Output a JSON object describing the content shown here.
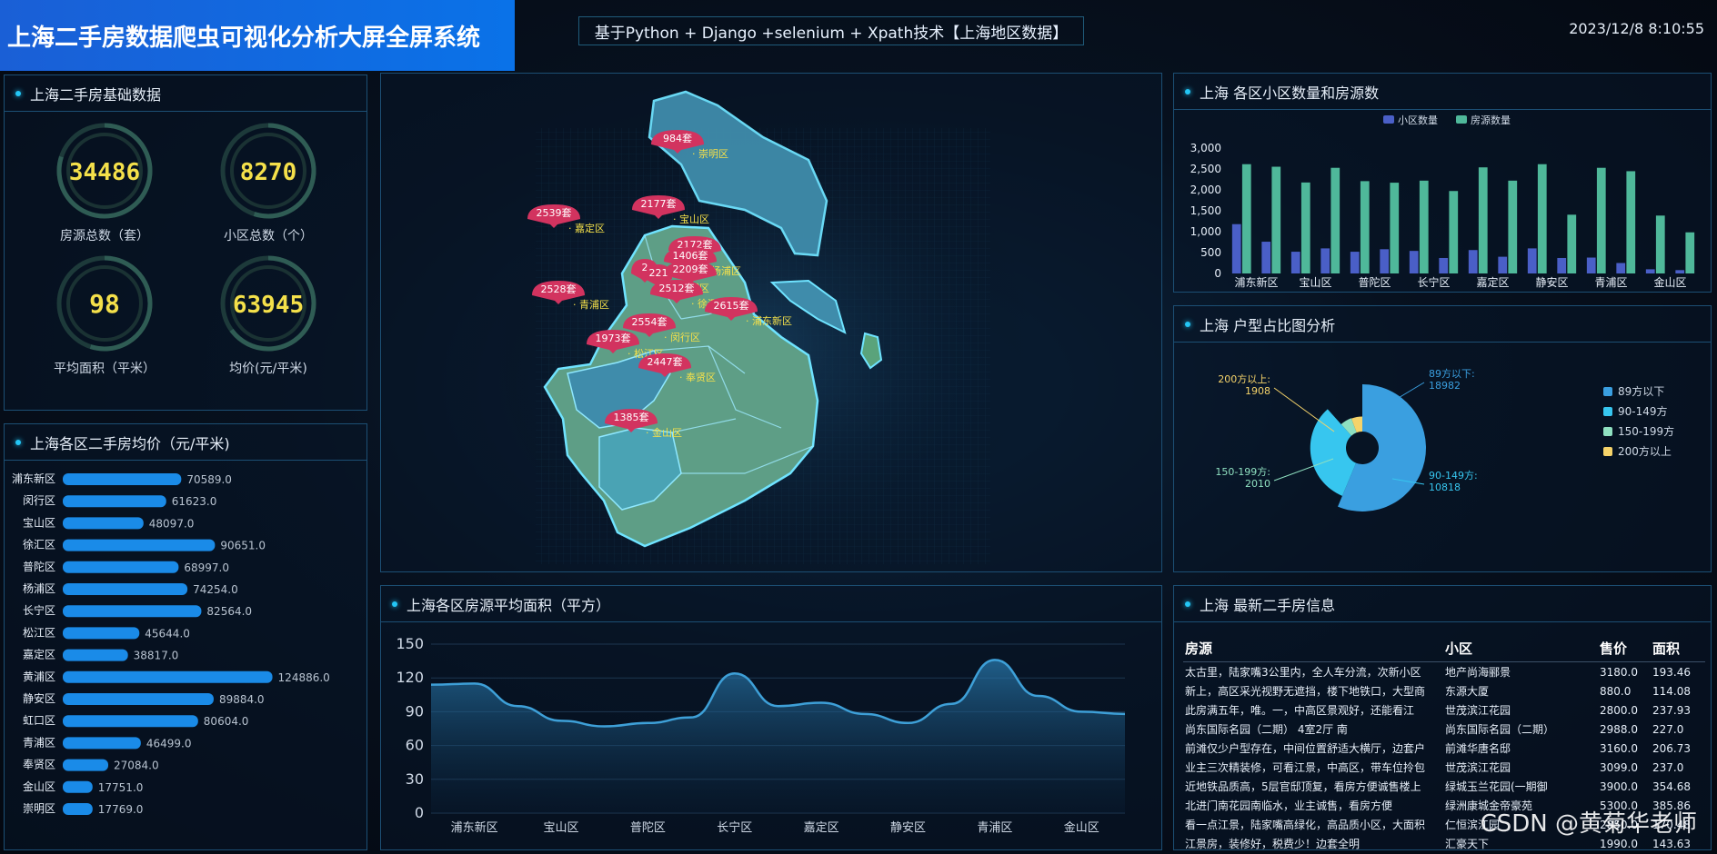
{
  "header": {
    "title": "上海二手房数据爬虫可视化分析大屏全屏系统",
    "subtitle": "基于Python + Django +selenium + Xpath技术【上海地区数据】",
    "datetime": "2023/12/8 8:10:55"
  },
  "basic": {
    "title": "上海二手房基础数据",
    "stats": [
      {
        "value": "34486",
        "label": "房源总数（套）",
        "fraction": 0.8
      },
      {
        "value": "8270",
        "label": "小区总数（个）",
        "fraction": 0.55
      },
      {
        "value": "98",
        "label": "平均面积（平米）",
        "fraction": 0.55
      },
      {
        "value": "63945",
        "label": "均价(元/平米)",
        "fraction": 0.65
      }
    ]
  },
  "price": {
    "title": "上海各区二手房均价（元/平米)",
    "chart_data": {
      "type": "bar",
      "orientation": "horizontal",
      "categories": [
        "浦东新区",
        "闵行区",
        "宝山区",
        "徐汇区",
        "普陀区",
        "杨浦区",
        "长宁区",
        "松江区",
        "嘉定区",
        "黄浦区",
        "静安区",
        "虹口区",
        "青浦区",
        "奉贤区",
        "金山区",
        "崇明区"
      ],
      "values": [
        70589,
        61623,
        48097,
        90651,
        68997,
        74254,
        82564,
        45644,
        38817,
        124886,
        89884,
        80604,
        46499,
        27084,
        17751,
        17769
      ],
      "labels": [
        "70589.0",
        "61623.0",
        "48097.0",
        "90651.0",
        "68997.0",
        "74254.0",
        "82564.0",
        "45644.0",
        "38817.0",
        "124886.0",
        "89884.0",
        "80604.0",
        "46499.0",
        "27084.0",
        "17751.0",
        "17769.0"
      ],
      "color": "#1a8be8"
    }
  },
  "map": {
    "markers": [
      {
        "count": "984套",
        "district": "崇明区"
      },
      {
        "count": "2539套",
        "district": "嘉定区"
      },
      {
        "count": "2177套",
        "district": "宝山区"
      },
      {
        "count": "2172套",
        "district": ""
      },
      {
        "count": "1406套",
        "district": "杨浦区"
      },
      {
        "count": "2",
        "district": ""
      },
      {
        "count": "2209套",
        "district": ""
      },
      {
        "count": "221",
        "district": "黄浦区"
      },
      {
        "count": "2528套",
        "district": "青浦区"
      },
      {
        "count": "2512套",
        "district": "徐汇区"
      },
      {
        "count": "2615套",
        "district": "浦东新区"
      },
      {
        "count": "2554套",
        "district": "闵行区"
      },
      {
        "count": "1973套",
        "district": "松江区"
      },
      {
        "count": "2447套",
        "district": "奉贤区"
      },
      {
        "count": "1385套",
        "district": "金山区"
      }
    ]
  },
  "area": {
    "title": "上海各区房源平均面积（平方）",
    "chart_data": {
      "type": "area",
      "x": [
        "浦东新区",
        "宝山区",
        "普陀区",
        "长宁区",
        "嘉定区",
        "静安区",
        "青浦区",
        "金山区"
      ],
      "y_ticks": [
        "0",
        "30",
        "60",
        "90",
        "120",
        "150"
      ],
      "ylim": [
        0,
        150
      ],
      "points": [
        [
          0,
          114
        ],
        [
          0.5,
          115
        ],
        [
          1,
          95
        ],
        [
          1.5,
          82
        ],
        [
          2,
          77
        ],
        [
          2.5,
          80
        ],
        [
          3,
          85
        ],
        [
          3.5,
          124
        ],
        [
          4,
          95
        ],
        [
          4.5,
          98
        ],
        [
          5,
          88
        ],
        [
          5.5,
          80
        ],
        [
          6,
          97
        ],
        [
          6.5,
          136
        ],
        [
          7,
          104
        ],
        [
          7.5,
          90
        ],
        [
          8,
          88
        ]
      ],
      "color": "#3ea0d8"
    }
  },
  "community": {
    "title": "上海 各区小区数量和房源数",
    "chart_data": {
      "type": "bar",
      "legend": [
        "小区数量",
        "房源数量"
      ],
      "x_labels": [
        "浦东新区",
        "宝山区",
        "普陀区",
        "长宁区",
        "嘉定区",
        "静安区",
        "青浦区",
        "金山区"
      ],
      "y_ticks": [
        "0",
        "500",
        "1,000",
        "1,500",
        "2,000",
        "2,500",
        "3,000"
      ],
      "ylim": [
        0,
        3000
      ],
      "series": [
        {
          "name": "小区数量",
          "color": "#4a5fc7",
          "values": [
            1180,
            760,
            520,
            600,
            520,
            580,
            540,
            370,
            560,
            400,
            600,
            370,
            380,
            250,
            100,
            80
          ]
        },
        {
          "name": "房源数量",
          "color": "#4fb89a",
          "values": [
            2615,
            2554,
            2177,
            2528,
            2209,
            2172,
            2221,
            1973,
            2539,
            2221,
            2615,
            1406,
            2528,
            2447,
            1385,
            984
          ]
        }
      ]
    }
  },
  "layout": {
    "title": "上海 户型占比图分析",
    "chart_data": {
      "type": "pie",
      "slices": [
        {
          "name": "89方以下",
          "value": 18982,
          "color": "#3a9fe0",
          "label": "89方以下:",
          "num": "18982"
        },
        {
          "name": "90-149方",
          "value": 10818,
          "color": "#37c6ef",
          "label": "90-149方:",
          "num": "10818"
        },
        {
          "name": "150-199方",
          "value": 2010,
          "color": "#8fe0c0",
          "label": "150-199方:",
          "num": "2010"
        },
        {
          "name": "200方以上",
          "value": 1908,
          "color": "#f5d36a",
          "label": "200方以上:",
          "num": "1908"
        }
      ]
    }
  },
  "news": {
    "title": "上海 最新二手房信息",
    "headers": [
      "房源",
      "小区",
      "售价",
      "面积"
    ],
    "rows": [
      [
        "太古里，陆家嘴3公里内，全人车分流，次新小区",
        "地产尚海郦景",
        "3180.0",
        "193.46"
      ],
      [
        "新上，高区采光视野无遮挡，楼下地铁口，大型商",
        "东源大厦",
        "880.0",
        "114.08"
      ],
      [
        "此房满五年，唯。一，中高区景观好，还能看江",
        "世茂滨江花园",
        "2800.0",
        "237.93"
      ],
      [
        "尚东国际名园（二期） 4室2厅 南",
        "尚东国际名园（二期）",
        "2988.0",
        "227.0"
      ],
      [
        "前滩仅少户型存在，中间位置舒适大横厅，边套户",
        "前滩华唐名邸",
        "3160.0",
        "206.73"
      ],
      [
        "业主三次精装修，可看江景，中高区，带车位拎包",
        "世茂滨江花园",
        "3099.0",
        "237.0"
      ],
      [
        "近地铁品质高，5层官邸顶复，看房方便诚售楼上",
        "绿城玉兰花园(一期御",
        "3900.0",
        "354.68"
      ],
      [
        "北进门南花园南临水，业主诚售，看房方便",
        "绿洲康城金帝豪苑",
        "5300.0",
        "385.86"
      ],
      [
        "看一点江景，陆家嘴高绿化，高品质小区，大面积",
        "仁恒滨江园",
        "2850.0",
        "170.48"
      ],
      [
        "江景房，装修好，税费少！边套全明",
        "汇豪天下",
        "1990.0",
        "143.63"
      ]
    ]
  },
  "watermark": "CSDN @黄菊华老师"
}
